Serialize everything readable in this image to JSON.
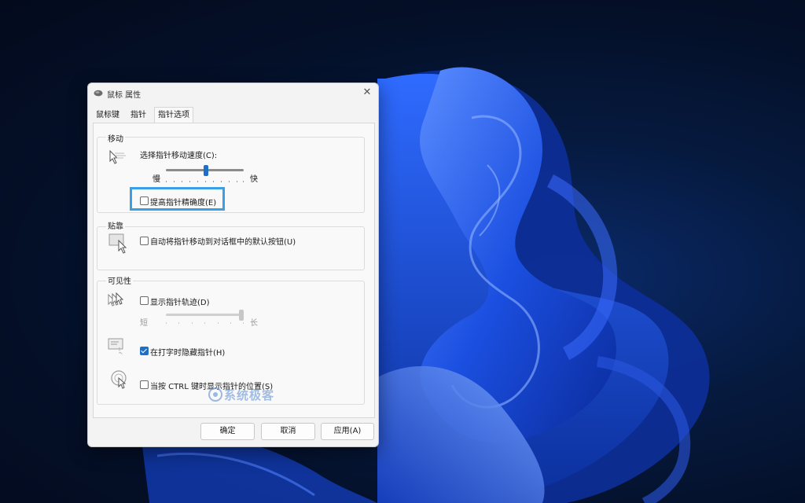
{
  "window": {
    "title": "鼠标 属性",
    "close_symbol": "✕"
  },
  "tabs": [
    {
      "label": "鼠标键"
    },
    {
      "label": "指针"
    },
    {
      "label": "指针选项",
      "active": true
    }
  ],
  "motion": {
    "group_title": "移动",
    "speed_label": "选择指针移动速度(C):",
    "slow_label": "慢",
    "fast_label": "快",
    "speed_value": 0.52,
    "precision_label": "提高指针精确度(E)",
    "precision_checked": false
  },
  "snap_to": {
    "group_title": "贴靠",
    "label": "自动将指针移动到对话框中的默认按钮(U)",
    "checked": false
  },
  "visibility": {
    "group_title": "可见性",
    "trails_label": "显示指针轨迹(D)",
    "trails_checked": false,
    "short_label": "短",
    "long_label": "长",
    "trails_value": 1.0,
    "hide_typing_label": "在打字时隐藏指针(H)",
    "hide_typing_checked": true,
    "ctrl_label": "当按 CTRL 键时显示指针的位置(S)",
    "ctrl_checked": false
  },
  "buttons": {
    "ok": "确定",
    "cancel": "取消",
    "apply": "应用(A)"
  },
  "watermark": "系统极客",
  "colors": {
    "accent": "#1f6fc7",
    "highlight": "#3aa0e6"
  }
}
